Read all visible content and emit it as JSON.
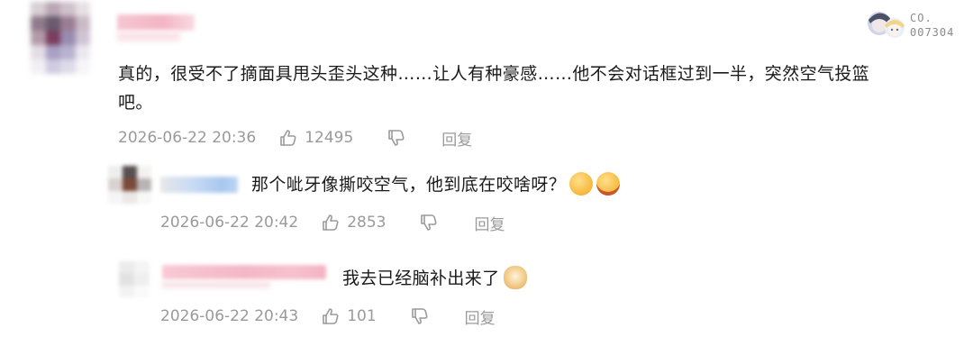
{
  "badge": {
    "line1": "CO.",
    "line2": "007304"
  },
  "comments": [
    {
      "text_line1": "真的，很受不了摘面具甩头歪头这种……让人有种豪感……他不会对话框过到一半，突然空气投篮",
      "text_line2": "吧。",
      "time": "2026-06-22 20:36",
      "likes": "12495",
      "reply_label": "回复"
    },
    {
      "text": "那个呲牙像撕咬空气，他到底在咬啥呀？",
      "time": "2026-06-22 20:42",
      "likes": "2853",
      "reply_label": "回复"
    },
    {
      "text": "我去已经脑补出来了",
      "time": "2026-06-22 20:43",
      "likes": "101",
      "reply_label": "回复"
    }
  ],
  "colors": {
    "meta_gray": "#9a9a9a",
    "text": "#1a1a1a",
    "blurred_name_pink": "#f4b8c6",
    "blurred_name_blue": "#a9c8ee"
  },
  "icons": {
    "like": "thumbs-up-icon",
    "dislike": "thumbs-down-icon",
    "emoji_1": "hand-over-face-emoji",
    "emoji_2": "grimace-emoji",
    "emoji_3": "dog-face-emoji"
  }
}
